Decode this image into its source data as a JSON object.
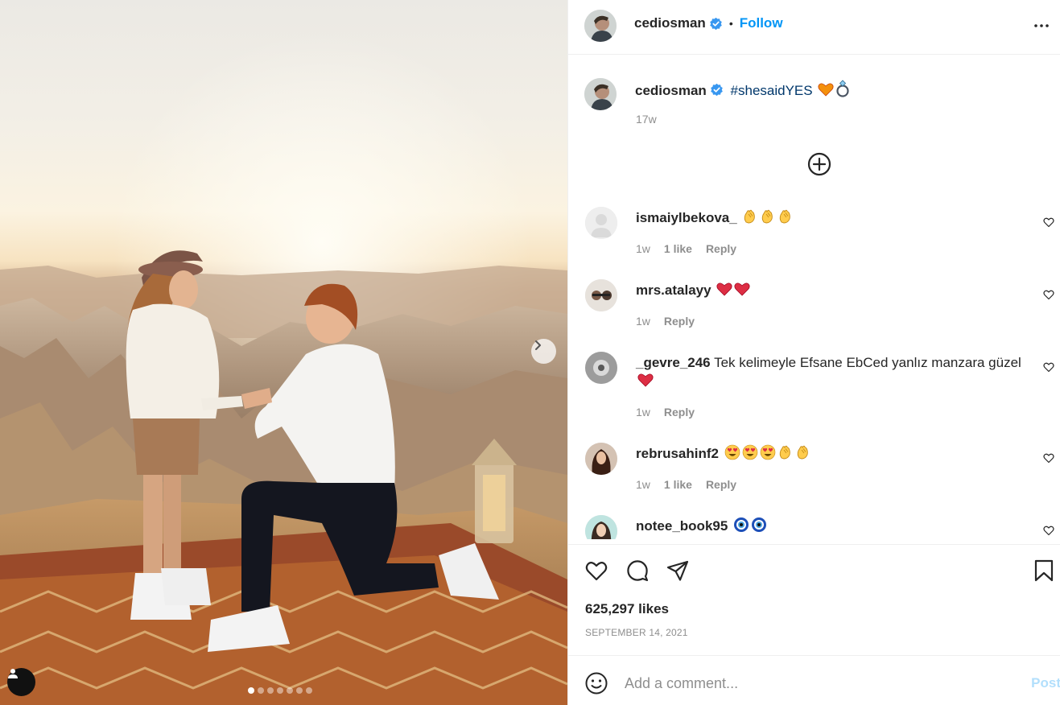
{
  "post": {
    "author": "cediosman",
    "follow_label": "Follow",
    "separator": "•",
    "caption_hashtag": "#shesaidYES",
    "caption_time": "17w",
    "likes": "625,297 likes",
    "date": "SEPTEMBER 14, 2021",
    "carousel": {
      "slide_count": 7,
      "active_slide": 1
    }
  },
  "comments": [
    {
      "user": "ismaiylbekova_",
      "text": "",
      "emoji": [
        "clap",
        "clap",
        "clap"
      ],
      "time": "1w",
      "likes": "1 like",
      "reply": "Reply"
    },
    {
      "user": "mrs.atalayy",
      "text": "",
      "emoji": [
        "heart",
        "heart"
      ],
      "time": "1w",
      "likes": "",
      "reply": "Reply"
    },
    {
      "user": "_gevre_246",
      "text": "Tek kelimeyle Efsane EbCed yanlız manzara güzel",
      "emoji": [
        "heart"
      ],
      "time": "1w",
      "likes": "",
      "reply": "Reply"
    },
    {
      "user": "rebrusahinf2",
      "text": "",
      "emoji": [
        "hearteyes",
        "hearteyes",
        "hearteyes",
        "clap",
        "clap"
      ],
      "time": "1w",
      "likes": "1 like",
      "reply": "Reply"
    },
    {
      "user": "notee_book95",
      "text": "",
      "emoji": [
        "nazar",
        "nazar"
      ],
      "time": "",
      "likes": "",
      "reply": ""
    }
  ],
  "comment_box": {
    "placeholder": "Add a comment...",
    "post_label": "Post"
  },
  "colors": {
    "accent": "#0095f6",
    "hashtag": "#00376b",
    "muted": "#8e8e8e",
    "verified": "#3897f0",
    "post_disabled": "#b2dffc"
  },
  "icons": [
    "more-icon",
    "verified-icon",
    "add-circle-icon",
    "heart-icon",
    "comment-icon",
    "share-icon",
    "bookmark-icon",
    "emoji-icon",
    "chevron-right-icon",
    "user-tag-icon"
  ]
}
